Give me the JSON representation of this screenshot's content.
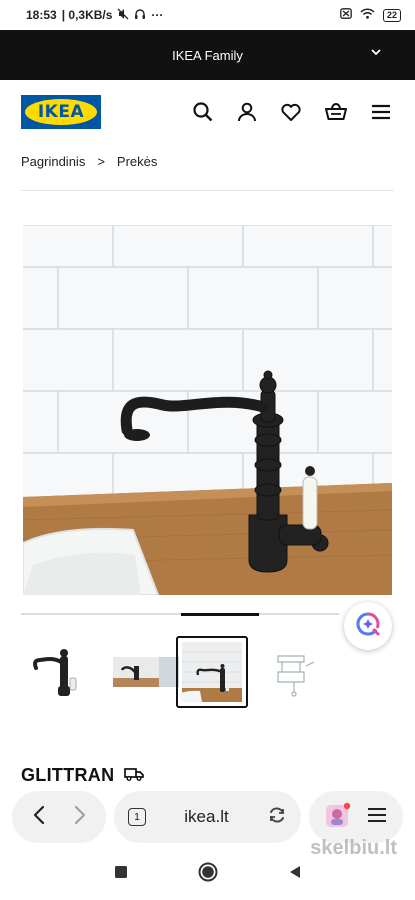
{
  "status_bar": {
    "time": "18:53",
    "speed": "| 0,3KB/s",
    "more": "···",
    "battery": "22"
  },
  "family_bar": {
    "label": "IKEA Family"
  },
  "header": {
    "logo_text": "IKEA",
    "icons": [
      "search-icon",
      "profile-icon",
      "heart-icon",
      "cart-icon",
      "menu-icon"
    ]
  },
  "breadcrumb": {
    "items": [
      "Pagrindinis",
      "Prekės"
    ],
    "separator": ">"
  },
  "product": {
    "name": "GLITTRAN",
    "thumbnail_selected_index": 2
  },
  "browser": {
    "tab_count": "1",
    "url": "ikea.lt"
  },
  "watermark": {
    "text": "skelbiu.lt"
  },
  "colors": {
    "ikea_blue": "#0058a3",
    "ikea_yellow": "#ffdb00",
    "family_bar_bg": "#111111"
  }
}
